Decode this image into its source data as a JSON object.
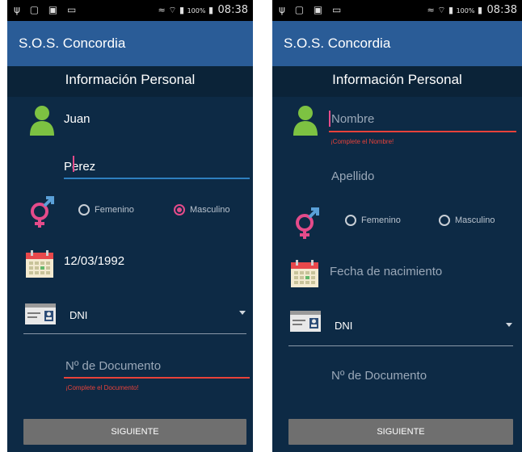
{
  "status_bar": {
    "time": "08:38",
    "battery": "100%"
  },
  "app": {
    "title": "S.O.S. Concordia"
  },
  "section": {
    "title": "Información Personal"
  },
  "gender": {
    "female": "Femenino",
    "male": "Masculino"
  },
  "doc_type": {
    "selected": "DNI"
  },
  "button": {
    "next": "SIGUIENTE"
  },
  "screen1": {
    "first_name": "Juan",
    "last_name": "Perez",
    "birth_date": "12/03/1992",
    "doc_number_hint": "Nº de Documento",
    "doc_error": "¡Complete el Documento!",
    "selected_gender": "Masculino"
  },
  "screen2": {
    "first_name_hint": "Nombre",
    "first_name_error": "¡Complete el Nombre!",
    "last_name_hint": "Apellido",
    "birth_date_hint": "Fecha de nacimiento",
    "doc_number_hint": "Nº de Documento"
  },
  "colors": {
    "appbar": "#2a5c97",
    "background": "#0d2a45",
    "accent": "#e44b8a",
    "error": "#e8423a",
    "person_icon": "#7dc242"
  }
}
